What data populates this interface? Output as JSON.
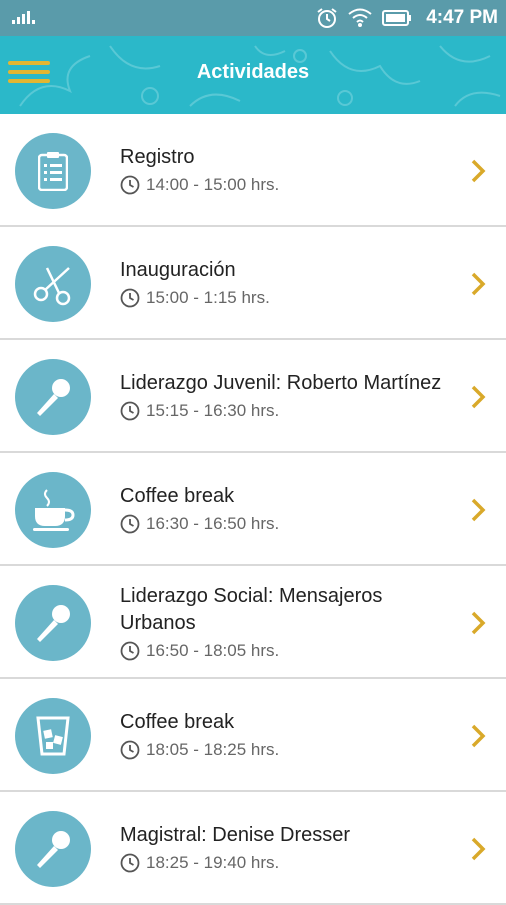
{
  "status_bar": {
    "time": "4:47 PM",
    "icons": [
      "signal-icon",
      "alarm-icon",
      "wifi-icon",
      "battery-icon"
    ]
  },
  "header": {
    "title": "Actividades",
    "menu_icon": "hamburger-menu-icon",
    "colors": {
      "background": "#2bb8c9",
      "accent": "#e2b632"
    }
  },
  "activities": [
    {
      "title": "Registro",
      "time": "14:00 - 15:00 hrs.",
      "icon": "clipboard-icon"
    },
    {
      "title": "Inauguración",
      "time": "15:00 - 1:15 hrs.",
      "icon": "scissors-icon"
    },
    {
      "title": "Liderazgo Juvenil: Roberto Martínez",
      "time": "15:15 - 16:30 hrs.",
      "icon": "microphone-icon"
    },
    {
      "title": "Coffee break",
      "time": "16:30 - 16:50 hrs.",
      "icon": "coffee-cup-icon"
    },
    {
      "title": "Liderazgo Social: Mensajeros Urbanos",
      "time": "16:50 - 18:05 hrs.",
      "icon": "microphone-icon"
    },
    {
      "title": "Coffee break",
      "time": "18:05 - 18:25 hrs.",
      "icon": "iced-drink-icon"
    },
    {
      "title": "Magistral: Denise Dresser",
      "time": "18:25 - 19:40 hrs.",
      "icon": "microphone-icon"
    }
  ],
  "colors": {
    "icon_circle": "#6bb6c9",
    "chevron": "#d9a92a",
    "divider": "#d9d9d9"
  }
}
